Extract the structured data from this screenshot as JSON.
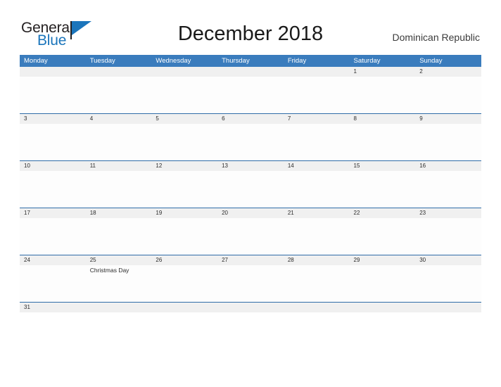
{
  "brand": {
    "name_part1": "General",
    "name_part2": "Blue",
    "flag_icon": "flag-triangle-icon",
    "color_primary": "#1b75bb",
    "color_text": "#231f20"
  },
  "header": {
    "title": "December 2018",
    "region": "Dominican Republic"
  },
  "calendar": {
    "header_background": "#3a7cbd",
    "row_separator_color": "#2f6ca8",
    "number_band_background": "#f0f0f0",
    "weekdays": [
      "Monday",
      "Tuesday",
      "Wednesday",
      "Thursday",
      "Friday",
      "Saturday",
      "Sunday"
    ],
    "weeks": [
      {
        "days": [
          {
            "date": "",
            "events": []
          },
          {
            "date": "",
            "events": []
          },
          {
            "date": "",
            "events": []
          },
          {
            "date": "",
            "events": []
          },
          {
            "date": "",
            "events": []
          },
          {
            "date": "1",
            "events": []
          },
          {
            "date": "2",
            "events": []
          }
        ]
      },
      {
        "days": [
          {
            "date": "3",
            "events": []
          },
          {
            "date": "4",
            "events": []
          },
          {
            "date": "5",
            "events": []
          },
          {
            "date": "6",
            "events": []
          },
          {
            "date": "7",
            "events": []
          },
          {
            "date": "8",
            "events": []
          },
          {
            "date": "9",
            "events": []
          }
        ]
      },
      {
        "days": [
          {
            "date": "10",
            "events": []
          },
          {
            "date": "11",
            "events": []
          },
          {
            "date": "12",
            "events": []
          },
          {
            "date": "13",
            "events": []
          },
          {
            "date": "14",
            "events": []
          },
          {
            "date": "15",
            "events": []
          },
          {
            "date": "16",
            "events": []
          }
        ]
      },
      {
        "days": [
          {
            "date": "17",
            "events": []
          },
          {
            "date": "18",
            "events": []
          },
          {
            "date": "19",
            "events": []
          },
          {
            "date": "20",
            "events": []
          },
          {
            "date": "21",
            "events": []
          },
          {
            "date": "22",
            "events": []
          },
          {
            "date": "23",
            "events": []
          }
        ]
      },
      {
        "days": [
          {
            "date": "24",
            "events": []
          },
          {
            "date": "25",
            "events": [
              "Christmas Day"
            ]
          },
          {
            "date": "26",
            "events": []
          },
          {
            "date": "27",
            "events": []
          },
          {
            "date": "28",
            "events": []
          },
          {
            "date": "29",
            "events": []
          },
          {
            "date": "30",
            "events": []
          }
        ]
      },
      {
        "short": true,
        "days": [
          {
            "date": "31",
            "events": []
          },
          {
            "date": "",
            "events": []
          },
          {
            "date": "",
            "events": []
          },
          {
            "date": "",
            "events": []
          },
          {
            "date": "",
            "events": []
          },
          {
            "date": "",
            "events": []
          },
          {
            "date": "",
            "events": []
          }
        ]
      }
    ]
  }
}
